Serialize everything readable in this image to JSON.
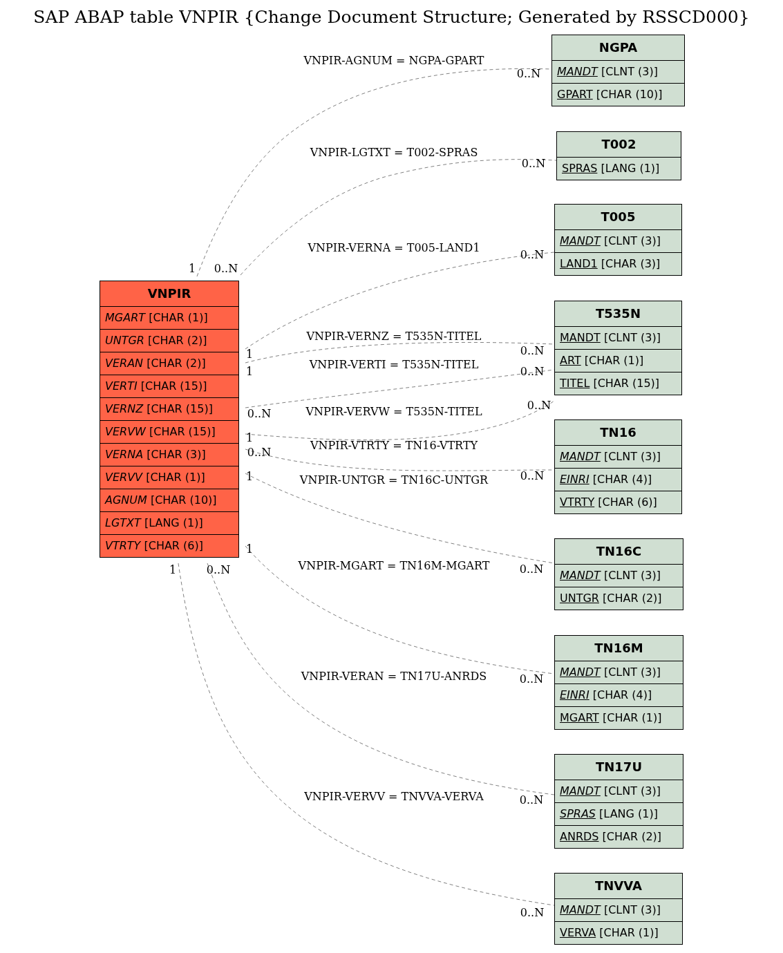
{
  "title": "SAP ABAP table VNPIR {Change Document Structure; Generated by RSSCD000}",
  "main_table": {
    "name": "VNPIR",
    "fields": [
      {
        "name": "MGART",
        "type": "[CHAR (1)]",
        "key": false,
        "foreign_key": true
      },
      {
        "name": "UNTGR",
        "type": "[CHAR (2)]",
        "key": false,
        "foreign_key": true
      },
      {
        "name": "VERAN",
        "type": "[CHAR (2)]",
        "key": false,
        "foreign_key": true
      },
      {
        "name": "VERTI",
        "type": "[CHAR (15)]",
        "key": false,
        "foreign_key": true
      },
      {
        "name": "VERNZ",
        "type": "[CHAR (15)]",
        "key": false,
        "foreign_key": true
      },
      {
        "name": "VERVW",
        "type": "[CHAR (15)]",
        "key": false,
        "foreign_key": true
      },
      {
        "name": "VERNA",
        "type": "[CHAR (3)]",
        "key": false,
        "foreign_key": true
      },
      {
        "name": "VERVV",
        "type": "[CHAR (1)]",
        "key": false,
        "foreign_key": true
      },
      {
        "name": "AGNUM",
        "type": "[CHAR (10)]",
        "key": false,
        "foreign_key": true
      },
      {
        "name": "LGTXT",
        "type": "[LANG (1)]",
        "key": false,
        "foreign_key": true
      },
      {
        "name": "VTRTY",
        "type": "[CHAR (6)]",
        "key": false,
        "foreign_key": true
      }
    ]
  },
  "related_tables": [
    {
      "name": "NGPA",
      "fields": [
        {
          "name": "MANDT",
          "type": "[CLNT (3)]",
          "key": true,
          "foreign_key": true
        },
        {
          "name": "GPART",
          "type": "[CHAR (10)]",
          "key": true,
          "foreign_key": false
        }
      ],
      "relations": [
        {
          "label": "VNPIR-AGNUM = NGPA-GPART",
          "source_card": "1",
          "target_card": "0..N"
        }
      ]
    },
    {
      "name": "T002",
      "fields": [
        {
          "name": "SPRAS",
          "type": "[LANG (1)]",
          "key": true,
          "foreign_key": false
        }
      ],
      "relations": [
        {
          "label": "VNPIR-LGTXT = T002-SPRAS",
          "source_card": "0..N",
          "target_card": "0..N"
        }
      ]
    },
    {
      "name": "T005",
      "fields": [
        {
          "name": "MANDT",
          "type": "[CLNT (3)]",
          "key": true,
          "foreign_key": true
        },
        {
          "name": "LAND1",
          "type": "[CHAR (3)]",
          "key": true,
          "foreign_key": false
        }
      ],
      "relations": [
        {
          "label": "VNPIR-VERNA = T005-LAND1",
          "source_card": "1",
          "target_card": "0..N"
        }
      ]
    },
    {
      "name": "T535N",
      "fields": [
        {
          "name": "MANDT",
          "type": "[CLNT (3)]",
          "key": true,
          "foreign_key": false
        },
        {
          "name": "ART",
          "type": "[CHAR (1)]",
          "key": true,
          "foreign_key": false
        },
        {
          "name": "TITEL",
          "type": "[CHAR (15)]",
          "key": true,
          "foreign_key": false
        }
      ],
      "relations": [
        {
          "label": "VNPIR-VERNZ = T535N-TITEL",
          "source_card": "1",
          "target_card": "0..N"
        },
        {
          "label": "VNPIR-VERTI = T535N-TITEL",
          "source_card": "0..N",
          "target_card": "0..N"
        },
        {
          "label": "VNPIR-VERVW = T535N-TITEL",
          "source_card": "1",
          "target_card": "0..N"
        }
      ]
    },
    {
      "name": "TN16",
      "fields": [
        {
          "name": "MANDT",
          "type": "[CLNT (3)]",
          "key": true,
          "foreign_key": true
        },
        {
          "name": "EINRI",
          "type": "[CHAR (4)]",
          "key": true,
          "foreign_key": true
        },
        {
          "name": "VTRTY",
          "type": "[CHAR (6)]",
          "key": true,
          "foreign_key": false
        }
      ],
      "relations": [
        {
          "label": "VNPIR-VTRTY = TN16-VTRTY",
          "source_card": "0..N",
          "target_card": "0..N"
        }
      ]
    },
    {
      "name": "TN16C",
      "fields": [
        {
          "name": "MANDT",
          "type": "[CLNT (3)]",
          "key": true,
          "foreign_key": true
        },
        {
          "name": "UNTGR",
          "type": "[CHAR (2)]",
          "key": true,
          "foreign_key": false
        }
      ],
      "relations": [
        {
          "label": "VNPIR-UNTGR = TN16C-UNTGR",
          "source_card": "1",
          "target_card": "0..N"
        }
      ]
    },
    {
      "name": "TN16M",
      "fields": [
        {
          "name": "MANDT",
          "type": "[CLNT (3)]",
          "key": true,
          "foreign_key": true
        },
        {
          "name": "EINRI",
          "type": "[CHAR (4)]",
          "key": true,
          "foreign_key": true
        },
        {
          "name": "MGART",
          "type": "[CHAR (1)]",
          "key": true,
          "foreign_key": false
        }
      ],
      "relations": [
        {
          "label": "VNPIR-MGART = TN16M-MGART",
          "source_card": "1",
          "target_card": "0..N"
        }
      ]
    },
    {
      "name": "TN17U",
      "fields": [
        {
          "name": "MANDT",
          "type": "[CLNT (3)]",
          "key": true,
          "foreign_key": true
        },
        {
          "name": "SPRAS",
          "type": "[LANG (1)]",
          "key": true,
          "foreign_key": true
        },
        {
          "name": "ANRDS",
          "type": "[CHAR (2)]",
          "key": true,
          "foreign_key": false
        }
      ],
      "relations": [
        {
          "label": "VNPIR-VERAN = TN17U-ANRDS",
          "source_card": "0..N",
          "target_card": "0..N"
        }
      ]
    },
    {
      "name": "TNVVA",
      "fields": [
        {
          "name": "MANDT",
          "type": "[CLNT (3)]",
          "key": true,
          "foreign_key": true
        },
        {
          "name": "VERVA",
          "type": "[CHAR (1)]",
          "key": true,
          "foreign_key": false
        }
      ],
      "relations": [
        {
          "label": "VNPIR-VERVV = TNVVA-VERVA",
          "source_card": "1",
          "target_card": "0..N"
        }
      ]
    }
  ]
}
